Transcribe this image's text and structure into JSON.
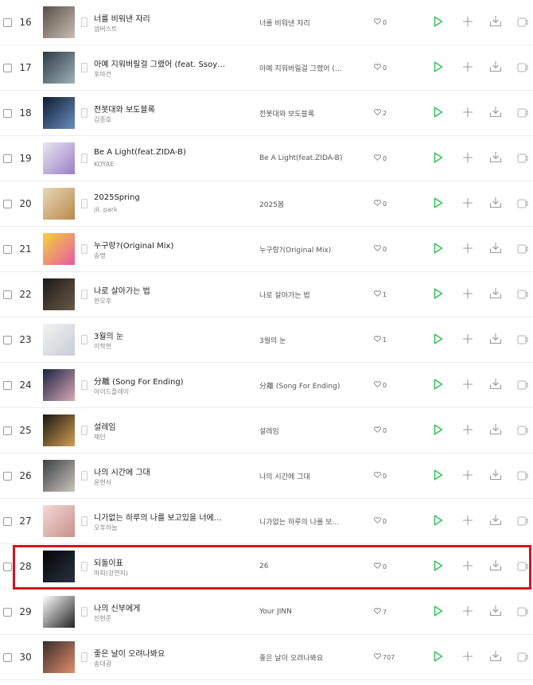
{
  "rows": [
    {
      "rank": "16",
      "title": "너를 비워낸 자리",
      "artist": "샘버스트",
      "album": "너를 비워낸 자리",
      "likes": "0",
      "c1": "#5a4e46",
      "c2": "#c8bfb4"
    },
    {
      "rank": "17",
      "title": "아예 지워버릴걸 그랬어 (feat. Ssoyo…",
      "artist": "포마건",
      "album": "아예 지워버릴걸 그랬어 (…",
      "likes": "0",
      "c1": "#2e3a44",
      "c2": "#9fb2b8"
    },
    {
      "rank": "18",
      "title": "전봇대와 보도블록",
      "artist": "김종호",
      "album": "전봇대와 보도블록",
      "likes": "2",
      "c1": "#0c1b33",
      "c2": "#6a8fc0"
    },
    {
      "rank": "19",
      "title": "Be A Light(feat.ZIDA-B)",
      "artist": "KOYAE",
      "album": "Be A Light(feat.ZIDA-B)",
      "likes": "0",
      "c1": "#e9e6ef",
      "c2": "#9b7ec8"
    },
    {
      "rank": "20",
      "title": "2025Spring",
      "artist": "jil. park",
      "album": "2025봄",
      "likes": "0",
      "c1": "#e8d7b8",
      "c2": "#b88a4a"
    },
    {
      "rank": "21",
      "title": "누구랑?(Original Mix)",
      "artist": "송명",
      "album": "누구랑?(Original Mix)",
      "likes": "0",
      "c1": "#f4d23c",
      "c2": "#e65aa4"
    },
    {
      "rank": "22",
      "title": "나로 살아가는 법",
      "artist": "한오후",
      "album": "나로 살아가는 법",
      "likes": "1",
      "c1": "#1c1a18",
      "c2": "#6b5a48"
    },
    {
      "rank": "23",
      "title": "3월의 눈",
      "artist": "이학현",
      "album": "3월의 눈",
      "likes": "1",
      "c1": "#f2f2f2",
      "c2": "#c7cdd4"
    },
    {
      "rank": "24",
      "title": "分離 (Song For Ending)",
      "artist": "아이드플레이",
      "album": "分離 (Song For Ending)",
      "likes": "0",
      "c1": "#1a2340",
      "c2": "#d9a8b8"
    },
    {
      "rank": "25",
      "title": "설레임",
      "artist": "재인",
      "album": "설레임",
      "likes": "0",
      "c1": "#1a1510",
      "c2": "#d1a055"
    },
    {
      "rank": "26",
      "title": "나의 시간에 그대",
      "artist": "윤현식",
      "album": "나의 시간에 그대",
      "likes": "0",
      "c1": "#3d4043",
      "c2": "#c9c5bd"
    },
    {
      "rank": "27",
      "title": "니가없는 하루의 나를 보고있을 너에…",
      "artist": "오후하늘",
      "album": "니가없는 하루의 나를 보…",
      "likes": "0",
      "c1": "#f3d9d6",
      "c2": "#c98f8a"
    },
    {
      "rank": "28",
      "title": "되돌이표",
      "artist": "마피(강연지)",
      "album": "26",
      "likes": "0",
      "c1": "#050608",
      "c2": "#2a3040"
    },
    {
      "rank": "29",
      "title": "나의 신부에게",
      "artist": "진현준",
      "album": "Your JINN",
      "likes": "7",
      "c1": "#ffffff",
      "c2": "#222222"
    },
    {
      "rank": "30",
      "title": "좋은 날이 오려나봐요",
      "artist": "송대광",
      "album": "좋은 날이 오려나봐요",
      "likes": "707",
      "c1": "#3b2a2a",
      "c2": "#e08e6b"
    }
  ],
  "icons": {
    "info": "info-icon",
    "like": "heart-icon",
    "play": "play-icon",
    "add": "plus-icon",
    "download": "download-icon",
    "mv": "mv-icon"
  },
  "colors": {
    "play": "#3fc262",
    "highlight": "#d9131e"
  }
}
